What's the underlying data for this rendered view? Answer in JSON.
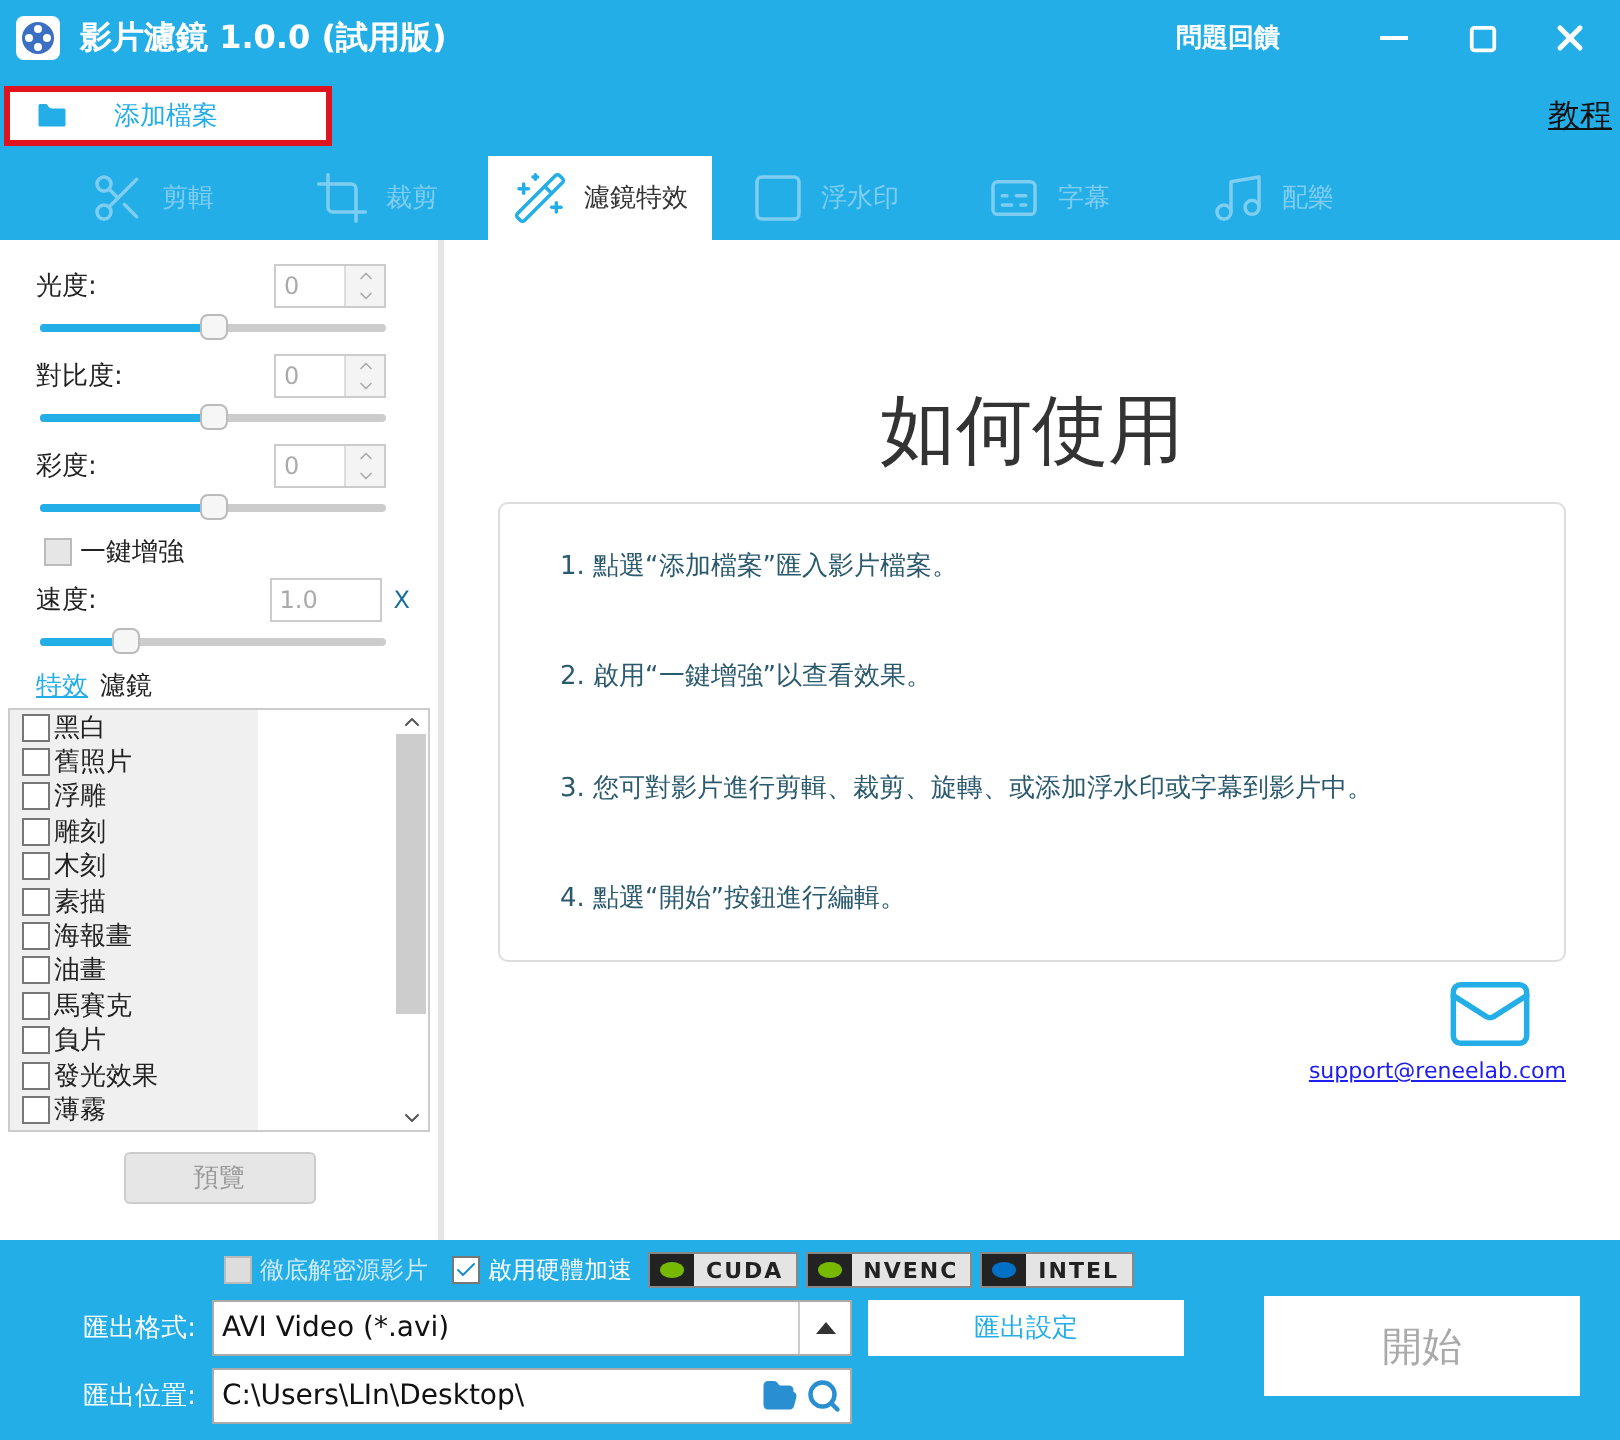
{
  "window": {
    "title": "影片濾鏡 1.0.0 (試用版)",
    "feedback": "問題回饋"
  },
  "toolbar": {
    "add_file": "添加檔案",
    "tutorial": "教程"
  },
  "tabs": [
    {
      "label": "剪輯",
      "selected": false
    },
    {
      "label": "裁剪",
      "selected": false
    },
    {
      "label": "濾鏡特效",
      "selected": true
    },
    {
      "label": "浮水印",
      "selected": false
    },
    {
      "label": "字幕",
      "selected": false
    },
    {
      "label": "配樂",
      "selected": false
    }
  ],
  "adjustments": [
    {
      "label": "光度:",
      "value": "0",
      "level": 0.5
    },
    {
      "label": "對比度:",
      "value": "0",
      "level": 0.5
    },
    {
      "label": "彩度:",
      "value": "0",
      "level": 0.5
    }
  ],
  "enhance": {
    "label": "一鍵增強",
    "checked": false
  },
  "speed": {
    "label": "速度:",
    "value": "1.0",
    "unit": "X",
    "level": 0.25
  },
  "effect_tabs": [
    {
      "label": "特效",
      "selected": true
    },
    {
      "label": "濾鏡",
      "selected": false
    }
  ],
  "effects": [
    {
      "label": "黑白",
      "checked": false
    },
    {
      "label": "舊照片",
      "checked": false
    },
    {
      "label": "浮雕",
      "checked": false
    },
    {
      "label": "雕刻",
      "checked": false
    },
    {
      "label": "木刻",
      "checked": false
    },
    {
      "label": "素描",
      "checked": false
    },
    {
      "label": "海報畫",
      "checked": false
    },
    {
      "label": "油畫",
      "checked": false
    },
    {
      "label": "馬賽克",
      "checked": false
    },
    {
      "label": "負片",
      "checked": false
    },
    {
      "label": "發光效果",
      "checked": false
    },
    {
      "label": "薄霧",
      "checked": false
    }
  ],
  "preview_button": "預覽",
  "help": {
    "title": "如何使用",
    "steps": [
      "1. 點選“添加檔案”匯入影片檔案。",
      "2. 啟用“一鍵增強”以查看效果。",
      "3. 您可對影片進行剪輯、裁剪、旋轉、或添加浮水印或字幕到影片中。",
      "4. 點選“開始”按鈕進行編輯。"
    ],
    "email": "support@reneelab.com"
  },
  "output": {
    "options": [
      {
        "label": "徹底解密源影片",
        "checked": false,
        "disabled": true
      },
      {
        "label": "啟用硬體加速",
        "checked": true,
        "disabled": false
      }
    ],
    "accelerators": [
      {
        "label": "CUDA",
        "color": "#76b900"
      },
      {
        "label": "NVENC",
        "color": "#76b900"
      },
      {
        "label": "INTEL",
        "color": "#0071c5"
      }
    ],
    "format_label": "匯出格式:",
    "format": "AVI Video (*.avi)",
    "settings_button": "匯出設定",
    "location_label": "匯出位置:",
    "location": "C:\\Users\\LIn\\Desktop\\",
    "start_button": "開始"
  }
}
